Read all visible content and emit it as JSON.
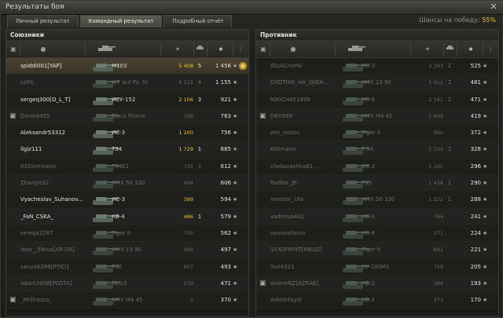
{
  "window": {
    "title": "Результаты боя",
    "close_label": "✕"
  },
  "tabs": [
    {
      "label": "Личный результат",
      "active": false
    },
    {
      "label": "Командный результат",
      "active": true
    },
    {
      "label": "Подробный отчёт",
      "active": false
    }
  ],
  "win_chance": {
    "label": "Шансы на победу:",
    "value": "55%"
  },
  "allies": {
    "title": "Союзники",
    "rows": [
      {
        "player": "spiddi001[YAP]",
        "tank": "M103",
        "damage": "5 408",
        "kills": "5",
        "xp": "1 456",
        "self": true,
        "dead": false,
        "platoon": false,
        "medal": true
      },
      {
        "player": "LeFiL",
        "tank": "WT auf Pz. IV",
        "damage": "5 115",
        "kills": "4",
        "xp": "1 155",
        "self": false,
        "dead": true,
        "platoon": false,
        "medal": false
      },
      {
        "player": "sergeq300[O_L_T]",
        "tank": "ИСУ-152",
        "damage": "2 106",
        "kills": "3",
        "xp": "921",
        "self": false,
        "dead": false,
        "platoon": false,
        "medal": false
      },
      {
        "player": "Denis4455",
        "tank": "Black Prince",
        "damage": "768",
        "kills": "",
        "xp": "763",
        "self": false,
        "dead": true,
        "platoon": true,
        "medal": false
      },
      {
        "player": "Aleksandr53312",
        "tank": "ИС-3",
        "damage": "1 200",
        "kills": "",
        "xp": "756",
        "self": false,
        "dead": false,
        "platoon": false,
        "medal": false
      },
      {
        "player": "ilgiz111",
        "tank": "T34",
        "damage": "1 729",
        "kills": "1",
        "xp": "685",
        "self": false,
        "dead": false,
        "platoon": false,
        "medal": false
      },
      {
        "player": "01Dominator",
        "tank": "T54E1",
        "damage": "735",
        "kills": "1",
        "xp": "612",
        "self": false,
        "dead": true,
        "platoon": false,
        "medal": false
      },
      {
        "player": "Zhangir02",
        "tank": "AMX 50 100",
        "damage": "904",
        "kills": "",
        "xp": "606",
        "self": false,
        "dead": true,
        "platoon": false,
        "medal": false
      },
      {
        "player": "Vyacheslav_Suhanov...",
        "tank": "ИС-3",
        "damage": "399",
        "kills": "",
        "xp": "594",
        "self": false,
        "dead": false,
        "platoon": false,
        "medal": false
      },
      {
        "player": "_FaN_CSKA_",
        "tank": "КВ-4",
        "damage": "486",
        "kills": "1",
        "xp": "579",
        "self": false,
        "dead": false,
        "platoon": false,
        "medal": false
      },
      {
        "player": "serega2287",
        "tank": "Tiger II",
        "damage": "750",
        "kills": "",
        "xp": "562",
        "self": false,
        "dead": true,
        "platoon": false,
        "medal": false
      },
      {
        "player": "lexa__58rus[AR-DA]",
        "tank": "AMX 13 90",
        "damage": "494",
        "kills": "",
        "xp": "497",
        "self": false,
        "dead": true,
        "platoon": false,
        "medal": false
      },
      {
        "player": "sanya4269[PTICI]",
        "tank": "T32",
        "damage": "607",
        "kills": "",
        "xp": "493",
        "self": false,
        "dead": true,
        "platoon": false,
        "medal": false
      },
      {
        "player": "adam3006[POSTA]",
        "tank": "T25/2",
        "damage": "539",
        "kills": "",
        "xp": "471",
        "self": false,
        "dead": true,
        "platoon": false,
        "medal": false
      },
      {
        "player": "_MrDrazza_",
        "tank": "AMX M4 45",
        "damage": "0",
        "kills": "",
        "xp": "370",
        "self": false,
        "dead": true,
        "platoon": true,
        "medal": false
      }
    ]
  },
  "enemies": {
    "title": "Противник",
    "rows": [
      {
        "player": "IDuACnoPal",
        "tank": "ИС-3",
        "damage": "2 393",
        "kills": "2",
        "xp": "525",
        "dead": true,
        "platoon": false
      },
      {
        "player": "DXOTHIK_HA_OJIEH...",
        "tank": "AMX 13 90",
        "damage": "1 912",
        "kills": "2",
        "xp": "481",
        "dead": true,
        "platoon": false
      },
      {
        "player": "NIKICH451999",
        "tank": "ИС-6",
        "damage": "2 161",
        "kills": "2",
        "xp": "471",
        "dead": true,
        "platoon": false
      },
      {
        "player": "DKV999",
        "tank": "AMX M4 45",
        "damage": "1 649",
        "kills": "",
        "xp": "419",
        "dead": true,
        "platoon": true
      },
      {
        "player": "zloi_rostov",
        "tank": "Tiger II",
        "damage": "960",
        "kills": "",
        "xp": "372",
        "dead": true,
        "platoon": false
      },
      {
        "player": "Kellmann",
        "tank": "T-54",
        "damage": "1 154",
        "kills": "1",
        "xp": "328",
        "dead": true,
        "platoon": false
      },
      {
        "player": "cheburashka83...",
        "tank": "ИС-3",
        "damage": "1 160",
        "kills": "",
        "xp": "296",
        "dead": true,
        "platoon": false
      },
      {
        "player": "Radios_JR",
        "tank": "T95",
        "damage": "1 438",
        "kills": "1",
        "xp": "290",
        "dead": true,
        "platoon": false
      },
      {
        "player": "meister_Ufa",
        "tank": "AMX 50 100",
        "damage": "1 222",
        "kills": "1",
        "xp": "288",
        "dead": true,
        "platoon": false
      },
      {
        "player": "vadimus461",
        "tank": "КВ-4",
        "damage": "784",
        "kills": "",
        "xp": "241",
        "dead": true,
        "platoon": false
      },
      {
        "player": "novozaharov",
        "tank": "ИС-8",
        "damage": "371",
        "kills": "",
        "xp": "224",
        "dead": true,
        "platoon": false
      },
      {
        "player": "SYXOFRYKT[MBUZ]",
        "tank": "Tiger II",
        "damage": "641",
        "kills": "",
        "xp": "221",
        "dead": true,
        "platoon": false
      },
      {
        "player": "Yuri4321",
        "tank": "СУ-100М1",
        "damage": "758",
        "kills": "",
        "xp": "205",
        "dead": true,
        "platoon": false
      },
      {
        "player": "AnimeNZ[AZRAE]",
        "tank": "КВ-2",
        "damage": "384",
        "kills": "",
        "xp": "193",
        "dead": true,
        "platoon": true
      },
      {
        "player": "doktorfayst",
        "tank": "КВ-3",
        "damage": "373",
        "kills": "",
        "xp": "170",
        "dead": true,
        "platoon": false
      }
    ]
  },
  "icons": {
    "platoon": "platoon-icon",
    "player": "player-icon",
    "tank": "tank-icon",
    "damage": "damage-icon",
    "kills": "kills-icon",
    "xp": "xp-star-icon",
    "medal": "medal-icon"
  },
  "colors": {
    "gold": "#e2c745",
    "self_row": "#4a4233"
  }
}
